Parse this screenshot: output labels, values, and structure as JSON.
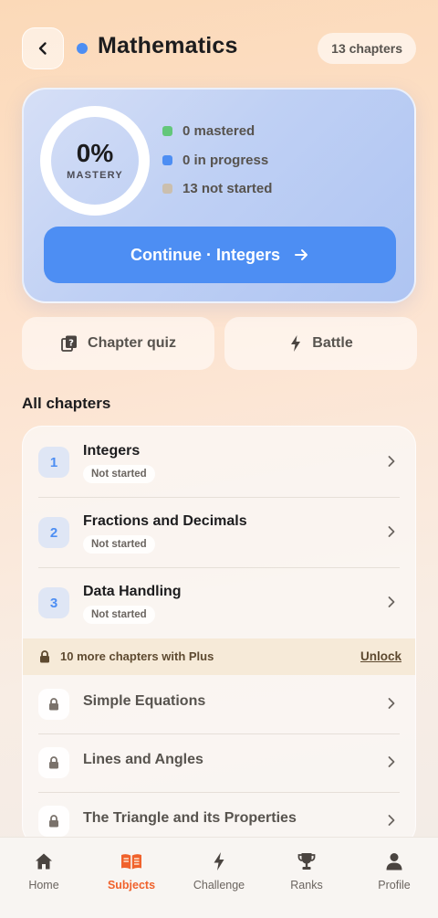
{
  "header": {
    "title": "Mathematics",
    "chapters_count": "13 chapters",
    "subject_color": "#4d8ef3"
  },
  "progress": {
    "percent_label": "0%",
    "percent_value": 0,
    "mastery_label": "MASTERY",
    "stats": [
      {
        "label": "0 mastered",
        "color": "#63c77a"
      },
      {
        "label": "0 in progress",
        "color": "#4d8ef3"
      },
      {
        "label": "13 not started",
        "color": "#cbbfae"
      }
    ],
    "continue_label": "Continue · Integers"
  },
  "actions": {
    "quiz_label": "Chapter quiz",
    "battle_label": "Battle"
  },
  "chapters": {
    "section_title": "All chapters",
    "items": [
      {
        "number": "1",
        "name": "Integers",
        "status": "Not started"
      },
      {
        "number": "2",
        "name": "Fractions and Decimals",
        "status": "Not started"
      },
      {
        "number": "3",
        "name": "Data Handling",
        "status": "Not started"
      }
    ],
    "plus_banner": {
      "text": "10 more chapters with Plus",
      "unlock_label": "Unlock"
    },
    "locked": [
      {
        "name": "Simple Equations"
      },
      {
        "name": "Lines and Angles"
      },
      {
        "name": "The Triangle and its Properties"
      }
    ]
  },
  "nav": {
    "items": [
      {
        "label": "Home",
        "icon": "home-icon"
      },
      {
        "label": "Subjects",
        "icon": "book-icon",
        "active": true
      },
      {
        "label": "Challenge",
        "icon": "bolt-icon"
      },
      {
        "label": "Ranks",
        "icon": "trophy-icon"
      },
      {
        "label": "Profile",
        "icon": "user-icon"
      }
    ],
    "active_color": "#f0622c"
  }
}
